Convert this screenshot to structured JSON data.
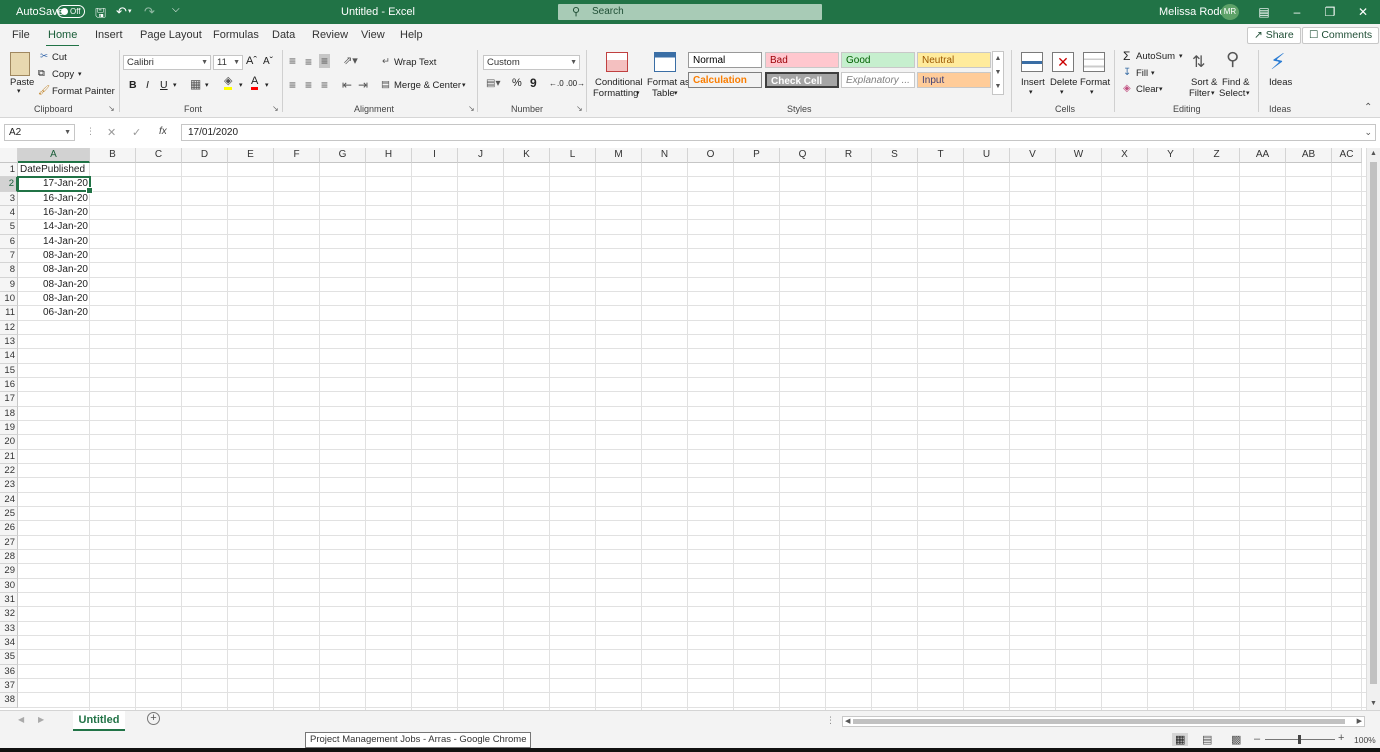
{
  "titlebar": {
    "autosave_label": "AutoSave",
    "autosave_state": "Off",
    "doc_title": "Untitled  -  Excel",
    "search_placeholder": "Search",
    "user_name": "Melissa Roden",
    "user_initials": "MR"
  },
  "menu": {
    "tabs": [
      "File",
      "Home",
      "Insert",
      "Page Layout",
      "Formulas",
      "Data",
      "Review",
      "View",
      "Help"
    ],
    "active": "Home",
    "share_label": "Share",
    "comments_label": "Comments"
  },
  "ribbon": {
    "clipboard": {
      "paste": "Paste",
      "cut": "Cut",
      "copy": "Copy",
      "format_painter": "Format Painter",
      "group": "Clipboard"
    },
    "font": {
      "name": "Calibri",
      "size": "11",
      "group": "Font",
      "bold": "B",
      "italic": "I",
      "underline": "U"
    },
    "alignment": {
      "wrap_text": "Wrap Text",
      "merge_center": "Merge & Center",
      "group": "Alignment"
    },
    "number": {
      "format": "Custom",
      "percent": "%",
      "comma": "9",
      "group": "Number"
    },
    "styles": {
      "conditional": "Conditional",
      "formatting": "Formatting",
      "format_as": "Format as",
      "table": "Table",
      "cells": [
        {
          "label": "Normal",
          "bg": "#ffffff",
          "fg": "#000000"
        },
        {
          "label": "Bad",
          "bg": "#ffc7ce",
          "fg": "#9c0006"
        },
        {
          "label": "Good",
          "bg": "#c6efce",
          "fg": "#006100"
        },
        {
          "label": "Neutral",
          "bg": "#ffeb9c",
          "fg": "#9c5700"
        },
        {
          "label": "Calculation",
          "bg": "#f2f2f2",
          "fg": "#fa7d00"
        },
        {
          "label": "Check Cell",
          "bg": "#a5a5a5",
          "fg": "#ffffff"
        },
        {
          "label": "Explanatory ...",
          "bg": "#ffffff",
          "fg": "#7f7f7f"
        },
        {
          "label": "Input",
          "bg": "#ffcc99",
          "fg": "#3f3f76"
        }
      ],
      "group": "Styles"
    },
    "cells_group": {
      "insert": "Insert",
      "delete": "Delete",
      "format": "Format",
      "group": "Cells"
    },
    "editing": {
      "autosum": "AutoSum",
      "fill": "Fill",
      "clear": "Clear",
      "sort": "Sort &",
      "filter": "Filter",
      "find": "Find &",
      "select": "Select",
      "group": "Editing"
    },
    "ideas": {
      "label": "Ideas",
      "group": "Ideas"
    }
  },
  "formula_bar": {
    "name_box": "A2",
    "fx": "fx",
    "value": "17/01/2020"
  },
  "sheet": {
    "columns": [
      "A",
      "B",
      "C",
      "D",
      "E",
      "F",
      "G",
      "H",
      "I",
      "J",
      "K",
      "L",
      "M",
      "N",
      "O",
      "P",
      "Q",
      "R",
      "S",
      "T",
      "U",
      "V",
      "W",
      "X",
      "Y",
      "Z",
      "AA",
      "AB",
      "AC"
    ],
    "rows": [
      "1",
      "2",
      "3",
      "4",
      "5",
      "6",
      "7",
      "8",
      "9",
      "10",
      "11",
      "12",
      "13",
      "14",
      "15",
      "16",
      "17",
      "18",
      "19",
      "20",
      "21",
      "22",
      "23",
      "24",
      "25",
      "26",
      "27",
      "28",
      "29",
      "30",
      "31",
      "32",
      "33",
      "34",
      "35",
      "36",
      "37",
      "38"
    ],
    "header": "DatePublished",
    "values": [
      "17-Jan-20",
      "16-Jan-20",
      "16-Jan-20",
      "14-Jan-20",
      "14-Jan-20",
      "08-Jan-20",
      "08-Jan-20",
      "08-Jan-20",
      "08-Jan-20",
      "06-Jan-20"
    ],
    "selected": "A2"
  },
  "sheet_tabs": {
    "active": "Untitled"
  },
  "status": {
    "zoom": "100%",
    "tooltip": "Project Management Jobs - Arras - Google Chrome"
  }
}
